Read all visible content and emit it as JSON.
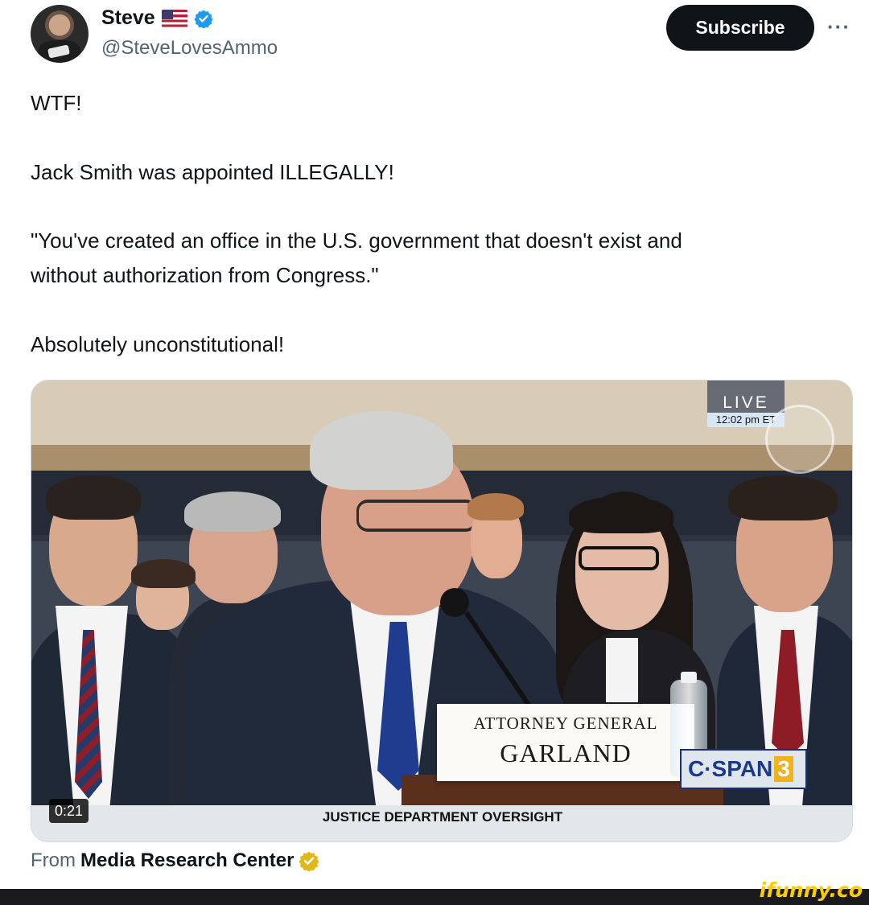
{
  "author": {
    "name": "Steve",
    "handle": "@SteveLovesAmmo",
    "flag_icon": "us-flag",
    "verified_icon": "blue-verified-badge"
  },
  "actions": {
    "subscribe_label": "Subscribe",
    "more_label": "···"
  },
  "tweet": {
    "line1": "WTF!",
    "line2": "Jack Smith was appointed ILLEGALLY!",
    "quote_line1": "\"You've created an office in the U.S. government that doesn't exist and",
    "quote_line2": "without authorization from Congress.\"",
    "line4": "Absolutely unconstitutional!"
  },
  "video": {
    "live_label": "LIVE",
    "live_time": "12:02 pm ET",
    "nameplate_line1": "ATTORNEY GENERAL",
    "nameplate_line2": "GARLAND",
    "network_logo_main": "C·SPAN",
    "network_logo_num": "3",
    "caption": "JUSTICE DEPARTMENT OVERSIGHT",
    "timestamp": "0:21"
  },
  "source": {
    "prefix": "From",
    "name": "Media Research Center",
    "verified_icon": "gold-verified-badge"
  },
  "watermark": {
    "text": "ifunny.co"
  },
  "colors": {
    "text_primary": "#0f1419",
    "text_secondary": "#536471",
    "verified_blue": "#1d9bf0",
    "verified_gold": "#e2b719",
    "ifunny_yellow": "#ffcc00"
  }
}
